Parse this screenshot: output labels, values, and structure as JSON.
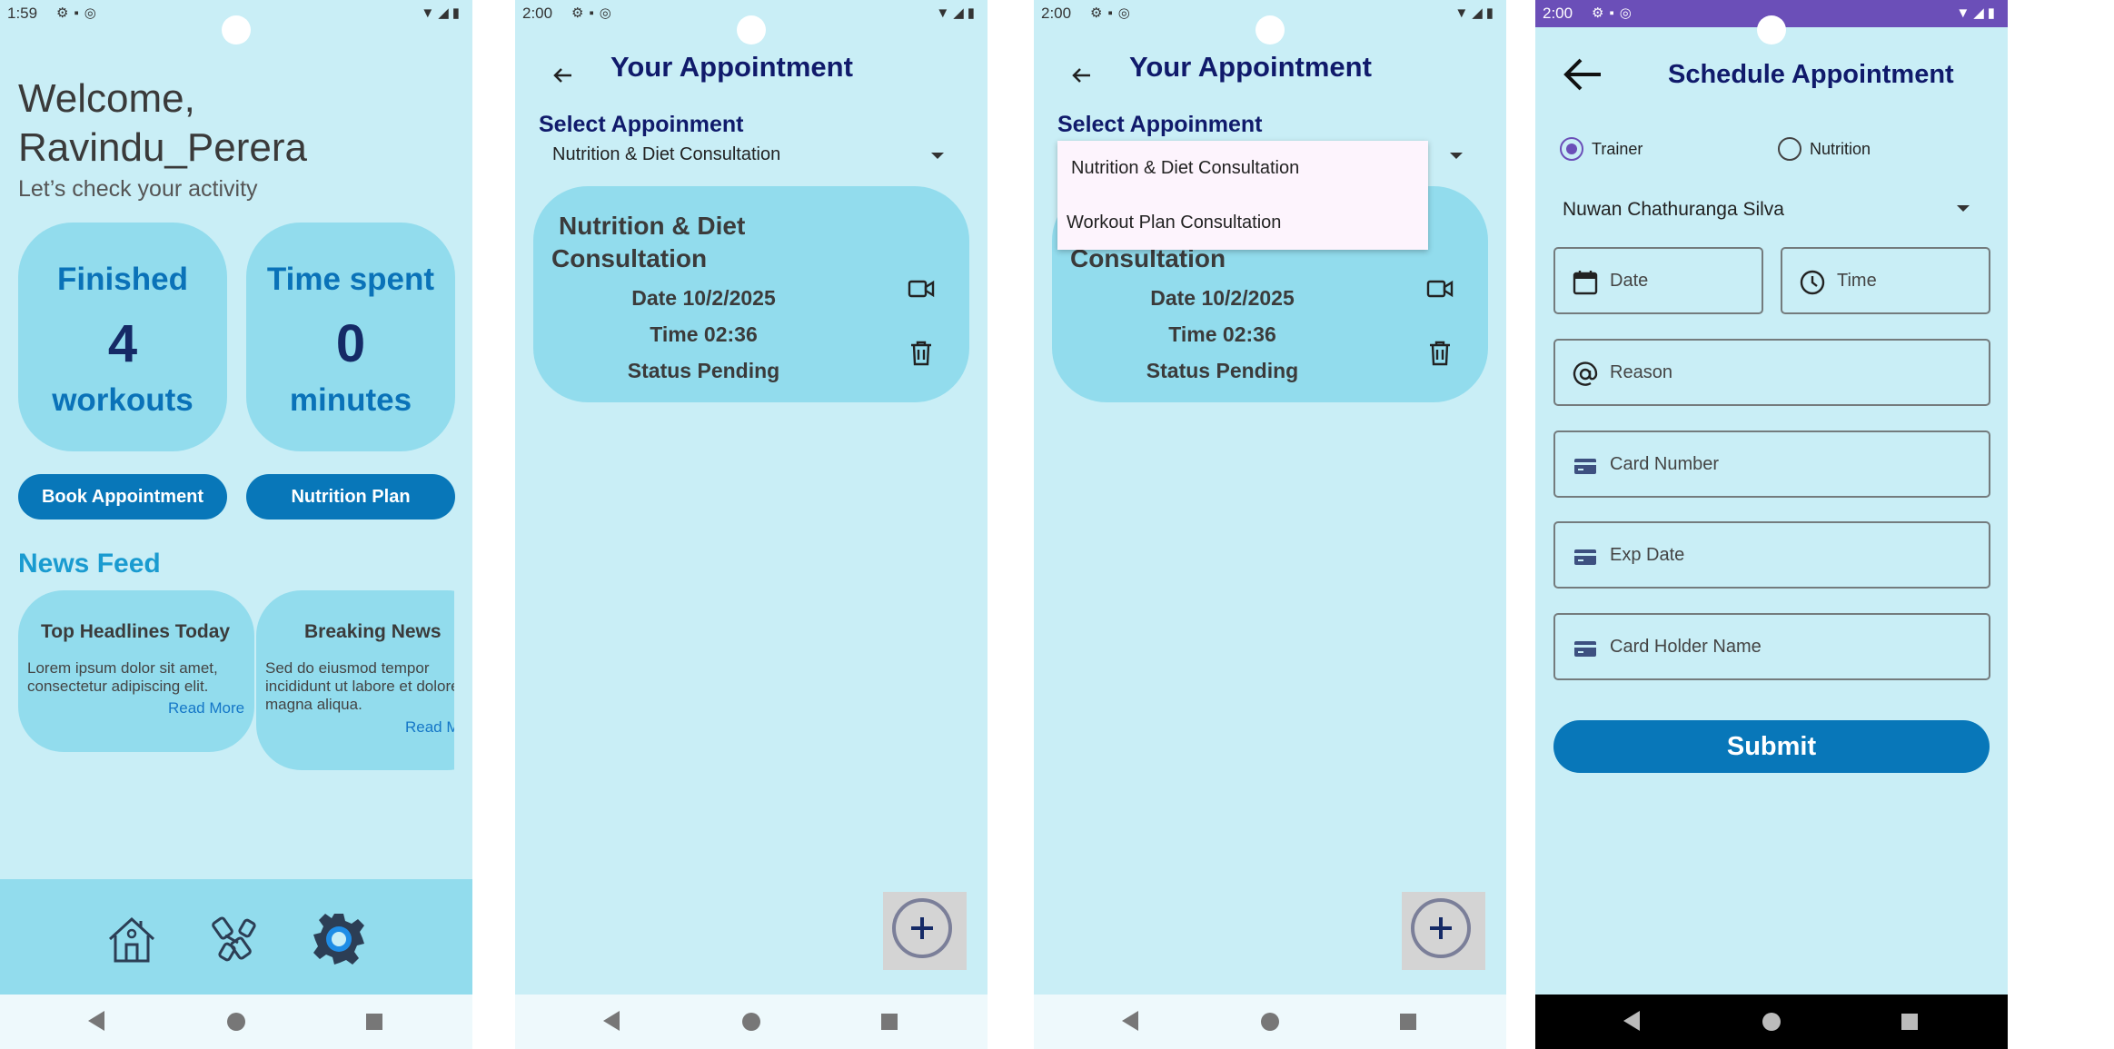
{
  "screen1": {
    "status": {
      "time": "1:59"
    },
    "welcome_line1": "Welcome,",
    "welcome_line2": "Ravindu_Perera",
    "subtitle": "Let’s check your activity",
    "stats": [
      {
        "label_top": "Finished",
        "value": "4",
        "label_bottom": "workouts"
      },
      {
        "label_top": "Time spent",
        "value": "0",
        "label_bottom": "minutes"
      }
    ],
    "book_button": "Book Appointment",
    "nutrition_button": "Nutrition Plan",
    "news_feed_title": "News Feed",
    "news": [
      {
        "title": "Top Headlines Today",
        "body": "Lorem ipsum dolor sit amet, consectetur adipiscing elit.",
        "link": "Read More"
      },
      {
        "title": "Breaking News",
        "body": "Sed do eiusmod tempor incididunt ut labore et dolore magna aliqua.",
        "link": "Read More"
      }
    ],
    "bottom_nav_icons": [
      "home-icon",
      "dumbbell-icon",
      "settings-gear-icon"
    ]
  },
  "screen2": {
    "status": {
      "time": "2:00"
    },
    "title": "Your Appointment",
    "select_label": "Select Appoinment",
    "selected": "Nutrition & Diet Consultation",
    "card": {
      "title_line1": "Nutrition & Diet",
      "title_line2": "Consultation",
      "date": "Date 10/2/2025",
      "time": "Time 02:36",
      "status": "Status Pending"
    }
  },
  "screen3": {
    "status": {
      "time": "2:00"
    },
    "title": "Your Appointment",
    "select_label": "Select Appoinment",
    "options": [
      "Nutrition & Diet Consultation",
      "Workout Plan Consultation"
    ],
    "card": {
      "title_line2": "Consultation",
      "date": "Date 10/2/2025",
      "time": "Time 02:36",
      "status": "Status Pending"
    }
  },
  "screen4": {
    "status": {
      "time": "2:00"
    },
    "title": "Schedule Appointment",
    "radio_trainer": "Trainer",
    "radio_nutrition": "Nutrition",
    "selected_trainer": "Nuwan Chathuranga Silva",
    "date_placeholder": "Date",
    "time_placeholder": "Time",
    "reason_placeholder": "Reason",
    "card_number_placeholder": "Card Number",
    "exp_date_placeholder": "Exp Date",
    "card_holder_placeholder": "Card Holder Name",
    "submit_label": "Submit"
  },
  "colors": {
    "background": "#c9eef6",
    "card": "#92dced",
    "primary_button": "#0877b9",
    "title": "#101a6b",
    "accent": "#6b4fb8"
  }
}
